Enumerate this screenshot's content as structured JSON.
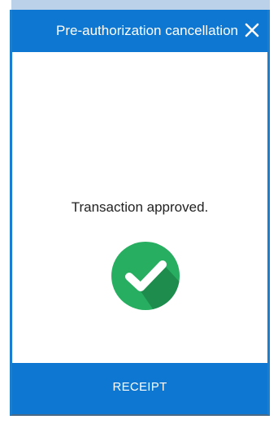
{
  "dialog": {
    "title": "Pre-authorization cancellation",
    "close_icon": "close-icon",
    "message": "Transaction approved.",
    "status_icon": "check-circle-icon",
    "receipt_label": "RECEIPT"
  },
  "colors": {
    "header_bg": "#0d77d1",
    "button_bg": "#0d77d1",
    "check_green": "#27ae60",
    "check_shadow": "#1e8c4d"
  }
}
